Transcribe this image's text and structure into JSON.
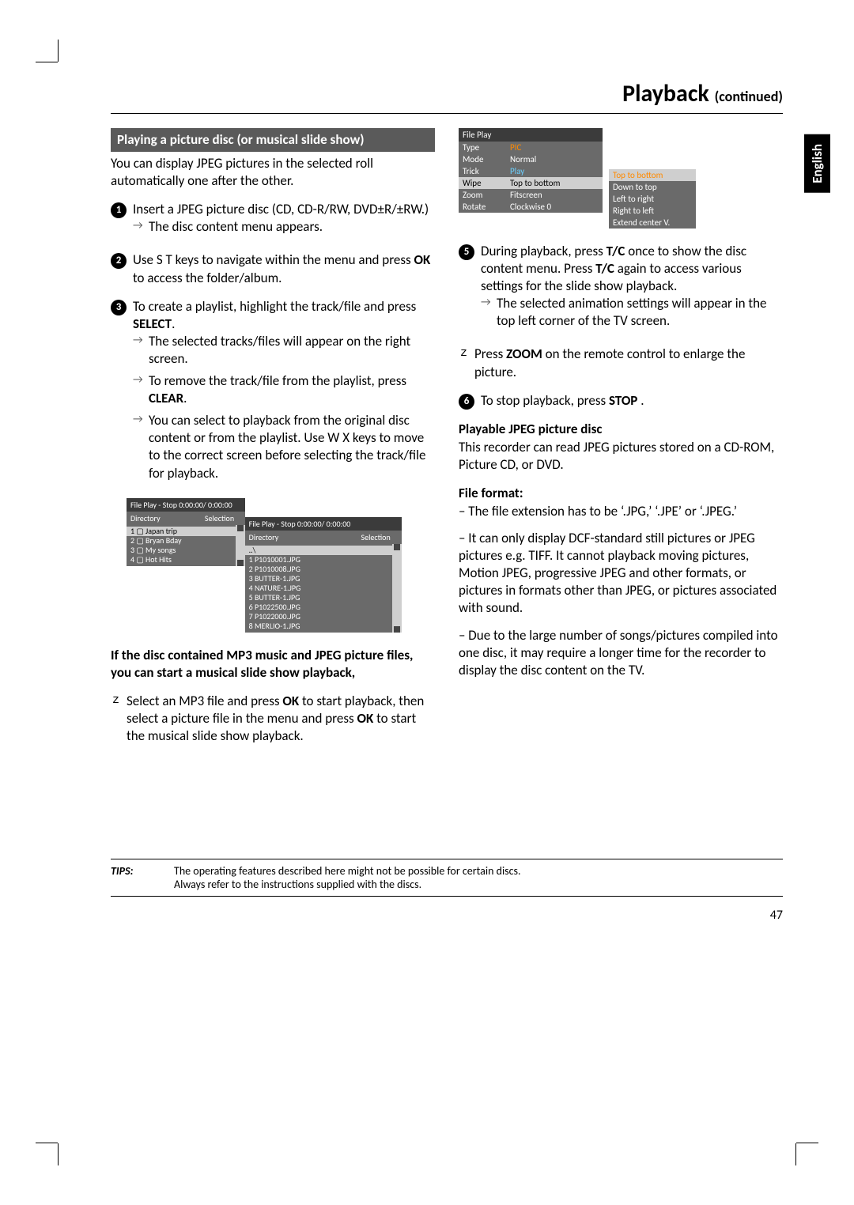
{
  "header": {
    "title": "Playback ",
    "continued": "(continued)"
  },
  "lang_tab": "English",
  "page_number": "47",
  "left": {
    "section_head": "Playing a picture disc (or musical slide show)",
    "intro": "You can display JPEG pictures in the selected roll automatically one after the other.",
    "step1_a": "Insert a JPEG picture disc (CD, CD-R/RW, DVD±R/±RW.)",
    "step1_b": "The disc content menu appears.",
    "step2": "Use  S T  keys to navigate within the menu and press OK to access the folder/album.",
    "step3_a": "To create a playlist, highlight the track/file and press SELECT.",
    "step3_b": "The selected tracks/files will appear on the right screen.",
    "step3_c": "To remove the track/file from the playlist, press CLEAR.",
    "step3_d": "You can select to playback from the original disc content or from the playlist. Use  W X keys to move to the correct screen before selecting the track/file for playback.",
    "fb1_title": "File Play - Stop 0:00:00/ 0:00:00",
    "fb_dir": "Directory",
    "fb_sel": "Selection",
    "fb1_items": [
      "1 ▢ Japan trip",
      "2 ▢ Bryan Bday",
      "3 ▢ My songs",
      "4 ▢ Hot Hits"
    ],
    "fb2_title": "File Play - Stop 0:00:00/ 0:00:00",
    "fb2_root": "..\\",
    "fb2_items": [
      "1   P1010001.JPG",
      "2   P1010008.JPG",
      "3   BUTTER-1.JPG",
      "4   NATURE-1.JPG",
      "5   BUTTER-1.JPG",
      "6   P1022500.JPG",
      "7   P1022000.JPG",
      "8   MERLIO-1.JPG"
    ],
    "mp3_head": "If the disc contained MP3 music and JPEG picture files, you can start a musical slide show playback,",
    "mp3_body": "Select an MP3 file and press OK to start playback, then select a picture file in the menu and press OK to start the musical slide show playback."
  },
  "right": {
    "menu_title": "File Play",
    "menu_rows": [
      {
        "k": "Type",
        "v": "PIC",
        "cls": "sp"
      },
      {
        "k": "Mode",
        "v": "Normal",
        "cls": ""
      },
      {
        "k": "Trick",
        "v": "Play",
        "cls": "sp2"
      },
      {
        "k": "Wipe",
        "v": "Top to bottom",
        "cls": "sel"
      },
      {
        "k": "Zoom",
        "v": "Fitscreen",
        "cls": ""
      },
      {
        "k": "Rotate",
        "v": "Clockwise 0",
        "cls": ""
      }
    ],
    "popup": [
      "Top to bottom",
      "Down to top",
      "Left to right",
      "Right to left",
      "Extend center V."
    ],
    "step5_a": "During playback, press T/C once to show the disc content menu. Press T/C again to access various settings for the slide show playback.",
    "step5_b": "The selected animation settings will appear in the top left corner of the TV screen.",
    "zoom": "Press ZOOM on the remote control to enlarge the picture.",
    "step6": "To stop playback, press STOP    .",
    "jpeg_head": "Playable JPEG picture disc",
    "jpeg_body": "This recorder can read JPEG pictures stored on a CD-ROM, Picture CD, or DVD.",
    "ff_head": "File format:",
    "ff1": "–  The file extension has to be ‘.JPG,’ ‘.JPE’ or ‘.JPEG.’",
    "ff2": "–  It can only display DCF-standard still pictures or JPEG pictures e.g. TIFF. It cannot playback moving pictures, Motion JPEG, progressive JPEG and other formats, or pictures in formats other than JPEG, or pictures associated with sound.",
    "ff3": "–  Due to the large number of songs/pictures compiled into one disc, it may require a longer time for the recorder to display the disc content on the TV."
  },
  "tips": {
    "label": "TIPS:",
    "line1": "The operating features described here might not be possible for certain discs.",
    "line2": "Always refer to the instructions supplied with the discs."
  }
}
